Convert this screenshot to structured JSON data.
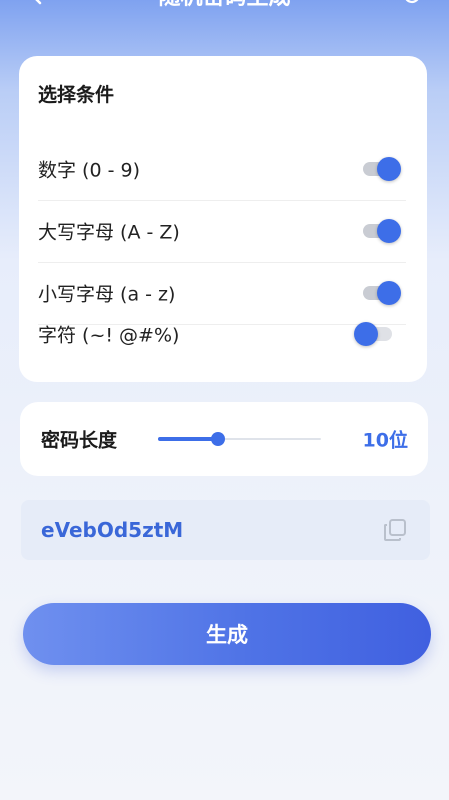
{
  "header": {
    "title": "随机密码生成",
    "back_icon": "back-arrow-icon",
    "refresh_icon": "refresh-icon"
  },
  "conditions": {
    "title": "选择条件",
    "options": [
      {
        "label": "数字 (0 - 9)",
        "enabled": true
      },
      {
        "label": "大写字母 (A - Z)",
        "enabled": true
      },
      {
        "label": "小写字母 (a - z)",
        "enabled": true
      },
      {
        "label": "字符 (~! @#%)",
        "enabled": false
      }
    ]
  },
  "length": {
    "label": "密码长度",
    "value_text": "10位",
    "value": 10,
    "slider_fraction": 0.37
  },
  "result": {
    "password": "eVebOd5ztM",
    "copy_icon": "copy-icon"
  },
  "generate_button": "生成",
  "colors": {
    "accent": "#3d6ee8",
    "toggle_off_track": "#dfe1e6",
    "result_bg": "#e6ecf8"
  }
}
